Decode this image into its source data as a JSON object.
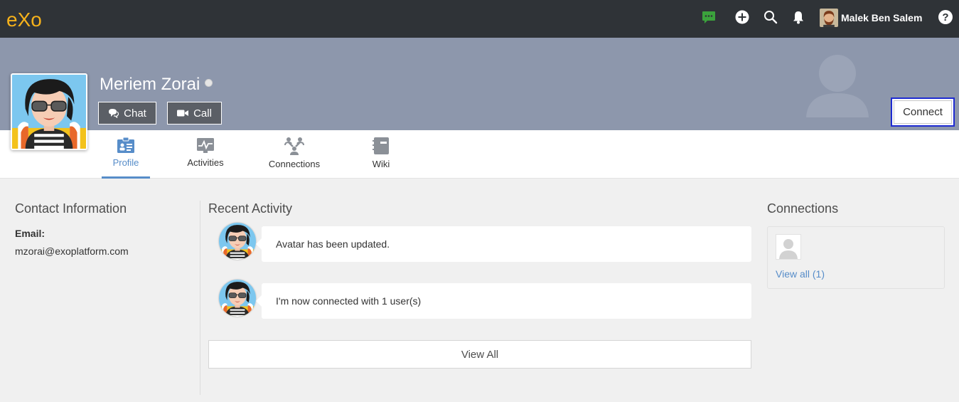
{
  "topbar": {
    "logo_text": "eXo",
    "user_name": "Malek Ben Salem",
    "icons": [
      "chat-icon",
      "add-icon",
      "search-icon",
      "notification-bell-icon",
      "help-icon"
    ],
    "chat_icon_color": "#3ba23c"
  },
  "profile": {
    "name": "Meriem Zorai",
    "status": "offline",
    "chat_label": "Chat",
    "call_label": "Call",
    "connect_label": "Connect"
  },
  "tabs": [
    {
      "label": "Profile",
      "icon": "profile-icon",
      "active": true
    },
    {
      "label": "Activities",
      "icon": "activities-icon",
      "active": false
    },
    {
      "label": "Connections",
      "icon": "connections-icon",
      "active": false
    },
    {
      "label": "Wiki",
      "icon": "wiki-icon",
      "active": false
    }
  ],
  "contact": {
    "title": "Contact Information",
    "email_label": "Email:",
    "email_value": "mzorai@exoplatform.com"
  },
  "recent_activity": {
    "title": "Recent Activity",
    "items": [
      {
        "text": "Avatar has been updated."
      },
      {
        "text": "I'm now connected with 1 user(s)"
      }
    ],
    "view_all_label": "View All"
  },
  "connections": {
    "title": "Connections",
    "view_all_link": "View all (1)"
  },
  "colors": {
    "topbar": "#2f3337",
    "banner": "#8d97ac",
    "accent": "#578dc9",
    "logo": "#f6b21b"
  }
}
